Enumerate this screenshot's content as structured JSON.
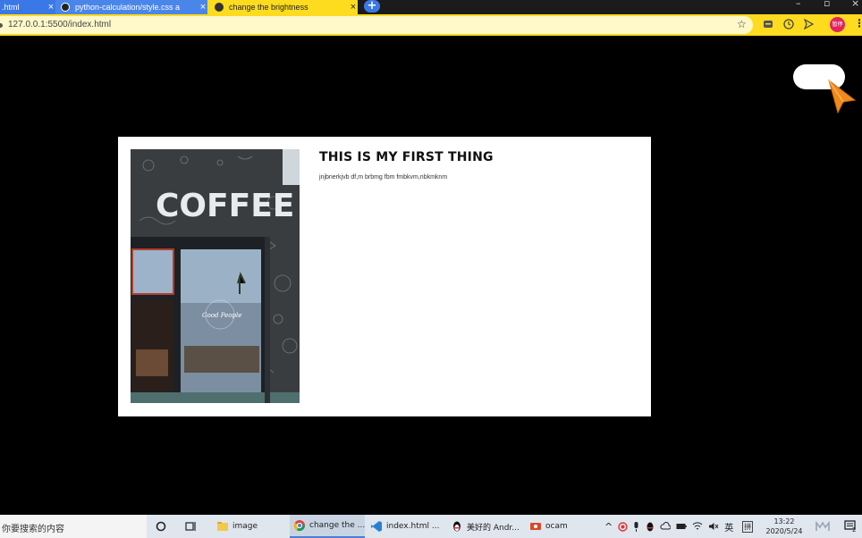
{
  "browser": {
    "tabs": [
      {
        "label": ".html",
        "close": "×"
      },
      {
        "label": "python-calculation/style.css a",
        "close": "×"
      },
      {
        "label": "change the brightness",
        "close": "×"
      }
    ],
    "new_tab": "+",
    "url": "127.0.0.1:5500/index.html",
    "profile_label": "暂停"
  },
  "page": {
    "card": {
      "title": "THIS IS MY FIRST THING",
      "text": "jnjbnerkjvb df,m brbmg fbm fmbkvm,nbkmknm",
      "image_sign": "COFFEE",
      "image_neon": "Good People"
    }
  },
  "taskbar": {
    "search_placeholder": "你要搜索的内容",
    "items": [
      {
        "label": "image"
      },
      {
        "label": "change the ..."
      },
      {
        "label": "index.html ..."
      },
      {
        "label": "美好的 Andr..."
      },
      {
        "label": "ocam"
      }
    ],
    "ime_lang": "英",
    "ime_mode": "拼",
    "time": "13:22",
    "date": "2020/5/24",
    "notification_count": "2"
  },
  "colors": {
    "tab_active": "#fddb1f",
    "tab_inactive": "#4a86ea",
    "toolbar": "#fddb1f",
    "cursor": "#f08a1c"
  }
}
